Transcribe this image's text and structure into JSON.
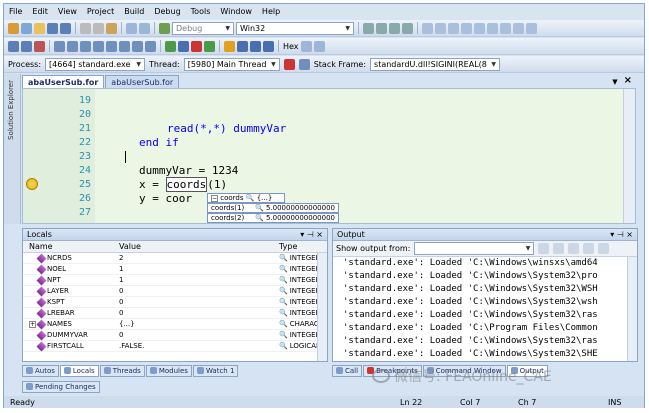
{
  "menu": [
    "File",
    "Edit",
    "View",
    "Project",
    "Build",
    "Debug",
    "Tools",
    "Window",
    "Help"
  ],
  "toolbar1": {
    "config": "Debug",
    "platform": "Win32"
  },
  "toolbar2": {
    "hex_label": "Hex"
  },
  "toolbar3": {
    "process_label": "Process:",
    "process_value": "[4664] standard.exe",
    "thread_label": "Thread:",
    "thread_value": "[5980] Main Thread",
    "stack_label": "Stack Frame:",
    "stack_value": "standardU.dll!SIGINI(REAL(8"
  },
  "tabs": [
    "abaUserSub.for",
    "abaUserSub.for"
  ],
  "sidebar_label": "Solution Explorer",
  "code_lines": [
    {
      "n": "19",
      "code": ""
    },
    {
      "n": "20",
      "code": ""
    },
    {
      "n": "21",
      "code": "read(*,*) dummyVar"
    },
    {
      "n": "22",
      "code": "end if"
    },
    {
      "n": "23",
      "code": ""
    },
    {
      "n": "24",
      "code": "dummyVar = 1234"
    },
    {
      "n": "25",
      "code": "x = coords(1)"
    },
    {
      "n": "26",
      "code": "y = coor"
    },
    {
      "n": "27",
      "code": ""
    }
  ],
  "datatip": {
    "top": "coords",
    "top_val": "{...}",
    "rows": [
      {
        "name": "coords(1)",
        "value": "5.00000000000000"
      },
      {
        "name": "coords(2)",
        "value": "5.00000000000000"
      }
    ]
  },
  "locals": {
    "title": "Locals",
    "headers": [
      "Name",
      "Value",
      "Type"
    ],
    "rows": [
      {
        "name": "NCRDS",
        "value": "2",
        "type": "INTEGER"
      },
      {
        "name": "NOEL",
        "value": "1",
        "type": "INTEGER"
      },
      {
        "name": "NPT",
        "value": "1",
        "type": "INTEGER"
      },
      {
        "name": "LAYER",
        "value": "0",
        "type": "INTEGER"
      },
      {
        "name": "KSPT",
        "value": "0",
        "type": "INTEGER"
      },
      {
        "name": "LREBAR",
        "value": "0",
        "type": "INTEGER"
      },
      {
        "name": "NAMES",
        "value": "{...}",
        "type": "CHARACT"
      },
      {
        "name": "DUMMYVAR",
        "value": "0",
        "type": "INTEGER"
      },
      {
        "name": "FIRSTCALL",
        "value": ".FALSE.",
        "type": "LOGICAL("
      }
    ]
  },
  "left_tabs": [
    "Autos",
    "Locals",
    "Threads",
    "Modules",
    "Watch 1"
  ],
  "left_tabs2": [
    "Pending Changes"
  ],
  "output": {
    "title": "Output",
    "show_label": "Show output from:",
    "lines": [
      "'standard.exe': Loaded 'C:\\Windows\\winsxs\\amd64",
      "'standard.exe': Loaded 'C:\\Windows\\System32\\pro",
      "'standard.exe': Loaded 'C:\\Windows\\System32\\WSH",
      "'standard.exe': Loaded 'C:\\Windows\\System32\\wsh",
      "'standard.exe': Loaded 'C:\\Windows\\System32\\ras",
      "'standard.exe': Loaded 'C:\\Program Files\\Common",
      "'standard.exe': Loaded 'C:\\Windows\\System32\\ras",
      "'standard.exe': Loaded 'C:\\Windows\\System32\\SHE"
    ]
  },
  "right_tabs": [
    "Call",
    "Breakpoints",
    "Command Window",
    "Output"
  ],
  "watermark": "微信号: FEAOnline_CAE",
  "status": {
    "ready": "Ready",
    "ln": "Ln 22",
    "col": "Col 7",
    "ch": "Ch 7",
    "ins": "INS"
  }
}
